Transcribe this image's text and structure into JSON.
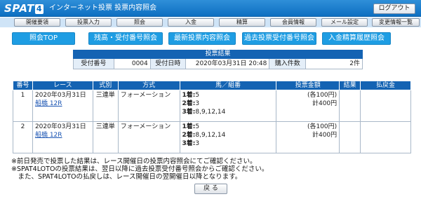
{
  "header": {
    "logo_text": "SPAT",
    "logo_num": "4",
    "title": "インターネット投票 投票内容照会",
    "logout_label": "ログアウト"
  },
  "nav": {
    "items": [
      {
        "label": "開催要領"
      },
      {
        "label": "投票入力"
      },
      {
        "label": "照会"
      },
      {
        "label": "入金"
      },
      {
        "label": "精算"
      },
      {
        "label": "会員情報"
      },
      {
        "label": "メール設定"
      },
      {
        "label": "変更情報一覧"
      }
    ]
  },
  "actions": [
    {
      "label": "照会TOP"
    },
    {
      "label": "残高・受付番号照会"
    },
    {
      "label": "最新投票内容照会"
    },
    {
      "label": "過去投票受付番号照会"
    },
    {
      "label": "入金精算履歴照会"
    }
  ],
  "summary": {
    "heading": "投票結果",
    "receipt_label": "受付番号",
    "receipt_value": "0004",
    "datetime_label": "受付日時",
    "datetime_value": "2020年03月31日 20:48",
    "count_label": "購入件数",
    "count_value": "2件"
  },
  "bets": {
    "headers": [
      "番号",
      "レース",
      "式別",
      "方式",
      "馬／組番",
      "投票金額",
      "結果",
      "払戻金"
    ],
    "rows": [
      {
        "no": "1",
        "date": "2020年03月31日",
        "race": "船橋 12R",
        "type": "三連単",
        "method": "フォーメーション",
        "pos1_label": "1着:",
        "pos1_value": "5",
        "pos2_label": "2着:",
        "pos2_value": "3",
        "pos3_label": "3着:",
        "pos3_value": "8,9,12,14",
        "unit": "(各100円)",
        "total": "計400円",
        "result": "",
        "payout": ""
      },
      {
        "no": "2",
        "date": "2020年03月31日",
        "race": "船橋 12R",
        "type": "三連単",
        "method": "フォーメーション",
        "pos1_label": "1着:",
        "pos1_value": "5",
        "pos2_label": "2着:",
        "pos2_value": "8,9,12,14",
        "pos3_label": "3着:",
        "pos3_value": "3",
        "unit": "(各100円)",
        "total": "計400円",
        "result": "",
        "payout": ""
      }
    ]
  },
  "notes": [
    "※前日発売で投票した結果は、レース開催日の投票内容照会にてご確認ください。",
    "※SPAT4LOTOの投票結果は、翌日以降に過去投票受付番号照会からご確認ください。",
    "　また、SPAT4LOTOの払戻しは、レース開催日の翌開催日以降となります。"
  ],
  "back_label": "戻 る"
}
